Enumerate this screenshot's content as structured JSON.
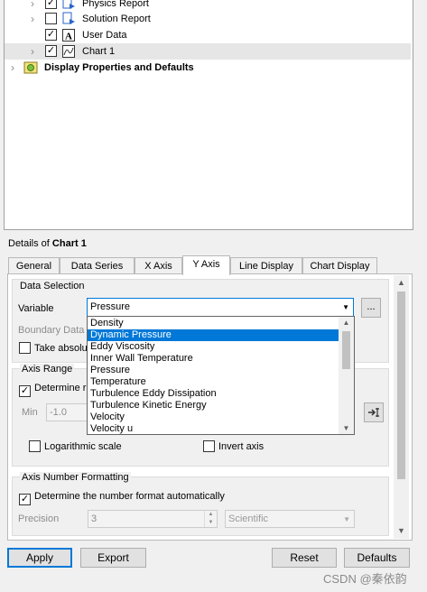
{
  "tree": {
    "items": [
      {
        "label": "Physics Report",
        "checked": true
      },
      {
        "label": "Solution Report",
        "checked": false
      },
      {
        "label": "User Data",
        "checked": true
      },
      {
        "label": "Chart 1",
        "checked": true
      },
      {
        "label": "Display Properties and Defaults"
      }
    ]
  },
  "details": {
    "prefix": "Details of ",
    "object": "Chart 1"
  },
  "tabs": [
    "General",
    "Data Series",
    "X Axis",
    "Y Axis",
    "Line Display",
    "Chart Display"
  ],
  "active_tab": "Y Axis",
  "data_selection": {
    "title": "Data Selection",
    "variable_label": "Variable",
    "variable_value": "Pressure",
    "browse_label": "...",
    "boundary_label": "Boundary Data",
    "take_label": "Take absolu"
  },
  "dropdown": {
    "items": [
      "Density",
      "Dynamic Pressure",
      "Eddy Viscosity",
      "Inner Wall Temperature",
      "Pressure",
      "Temperature",
      "Turbulence Eddy Dissipation",
      "Turbulence Kinetic Energy",
      "Velocity",
      "Velocity u"
    ],
    "highlighted": "Dynamic Pressure"
  },
  "axis_range": {
    "title": "Axis Range",
    "determine_label": "Determine ra",
    "min_label": "Min",
    "min_value": "-1.0",
    "log_label": "Logarithmic scale",
    "invert_label": "Invert axis"
  },
  "number_format": {
    "title": "Axis Number Formatting",
    "determine_label": "Determine the number format automatically",
    "precision_label": "Precision",
    "precision_value": "3",
    "format_value": "Scientific"
  },
  "buttons": {
    "apply": "Apply",
    "export": "Export",
    "reset": "Reset",
    "defaults": "Defaults"
  },
  "watermark": "CSDN @秦依韵",
  "icons": {
    "expand": "chevron-right-icon",
    "report": "report-icon",
    "user_data": "text-a-icon",
    "chart": "chart-icon",
    "display": "display-settings-icon",
    "pick": "pick-arrow-icon"
  }
}
